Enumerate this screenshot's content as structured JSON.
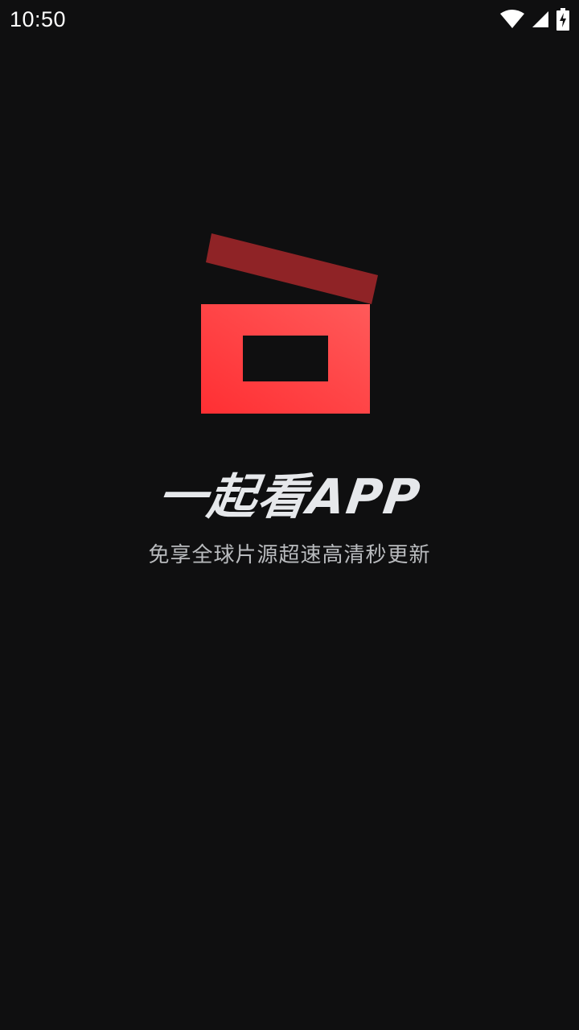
{
  "status_bar": {
    "time": "10:50",
    "icons": [
      "wifi-icon",
      "cellular-signal-icon",
      "battery-charging-icon"
    ]
  },
  "splash": {
    "title": "一起看APP",
    "slogan": "免享全球片源超速高清秒更新"
  },
  "colors": {
    "background": "#0f0f10",
    "logo_red": "#ff3b3b",
    "logo_bar": "#8f2326",
    "title": "#e6e8eb",
    "slogan": "#b9bbbe"
  }
}
